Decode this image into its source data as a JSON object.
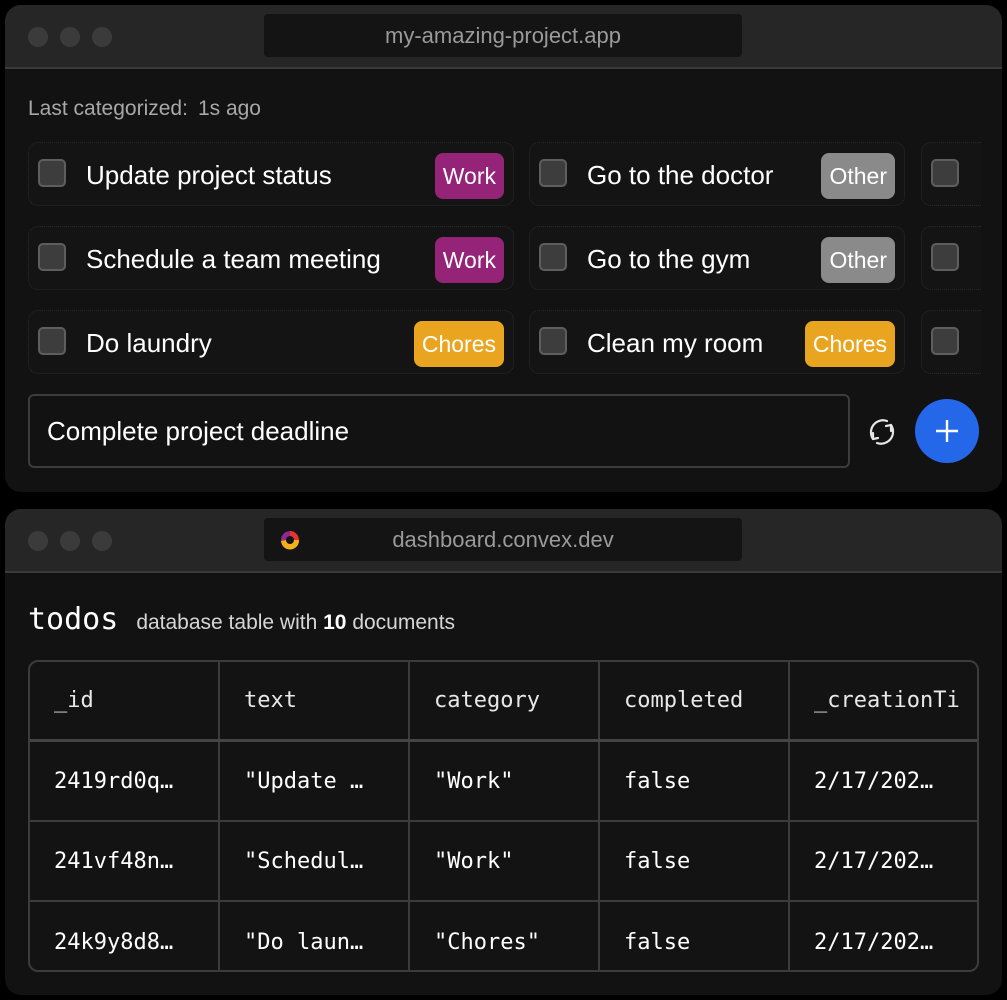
{
  "app_window": {
    "url": "my-amazing-project.app",
    "last_categorized_label": "Last categorized:",
    "last_categorized_value": "1s ago",
    "todos": [
      {
        "text": "Update project status",
        "category": "Work",
        "checked": false
      },
      {
        "text": "Go to the doctor",
        "category": "Other",
        "checked": false
      },
      {
        "text": "",
        "category": "",
        "checked": false
      },
      {
        "text": "Schedule a team meeting",
        "category": "Work",
        "checked": false
      },
      {
        "text": "Go to the gym",
        "category": "Other",
        "checked": false
      },
      {
        "text": "",
        "category": "",
        "checked": false
      },
      {
        "text": "Do laundry",
        "category": "Chores",
        "checked": false
      },
      {
        "text": "Clean my room",
        "category": "Chores",
        "checked": false
      },
      {
        "text": "",
        "category": "",
        "checked": false
      }
    ],
    "category_colors": {
      "Work": "#952479",
      "Other": "#8a8a8a",
      "Chores": "#e9a51f"
    },
    "new_todo_value": "Complete project deadline",
    "refresh_icon": "refresh-icon",
    "add_icon": "plus-icon",
    "add_button_color": "#2467e8"
  },
  "dashboard_window": {
    "url": "dashboard.convex.dev",
    "table_name": "todos",
    "desc_prefix": "database table with",
    "doc_count": "10",
    "desc_suffix": "documents",
    "columns": [
      "_id",
      "text",
      "category",
      "completed",
      "_creationTi"
    ],
    "rows": [
      [
        "2419rd0q…",
        "\"Update …",
        "\"Work\"",
        "false",
        "2/17/202…"
      ],
      [
        "241vf48n…",
        "\"Schedul…",
        "\"Work\"",
        "false",
        "2/17/202…"
      ],
      [
        "24k9y8d8…",
        "\"Do laun…",
        "\"Chores\"",
        "false",
        "2/17/202…"
      ]
    ]
  }
}
